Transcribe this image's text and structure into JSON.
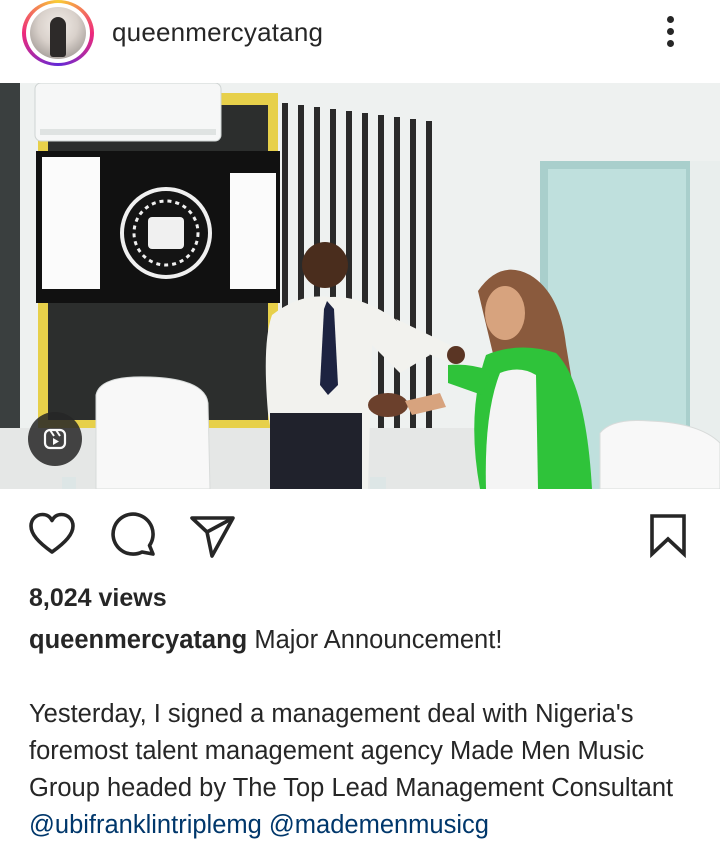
{
  "post": {
    "username": "queenmercyatang",
    "views": "8,024 views",
    "caption_title": "Major Announcement!",
    "caption_body": "Yesterday, I signed a management deal with Nigeria's foremost talent management agency Made Men Music Group headed by The Top Lead Management Consultant ",
    "mention_1": "@ubifranklintriplemg",
    "mention_2": "@mademenmusicg"
  },
  "icons": {
    "more": "more-vertical-icon",
    "like": "heart-icon",
    "comment": "comment-icon",
    "share": "send-icon",
    "save": "bookmark-icon",
    "reel": "reel-icon"
  },
  "colors": {
    "text": "#262626",
    "mention": "#00376b",
    "ring_start": "#f9ce34",
    "ring_mid": "#ee2a7b",
    "ring_end": "#6228d7"
  }
}
